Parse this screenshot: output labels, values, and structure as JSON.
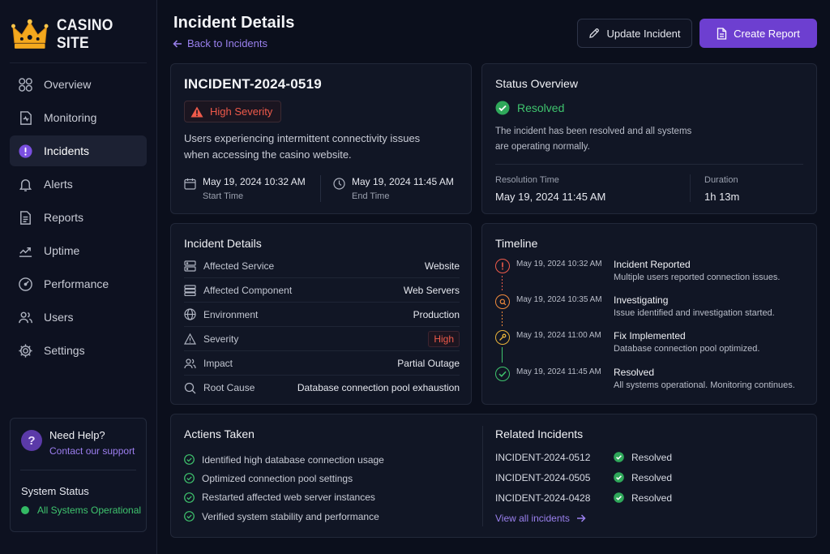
{
  "brand": {
    "name": "CASINO SITE"
  },
  "sidebar": {
    "items": [
      {
        "label": "Overview",
        "icon": "grid-icon",
        "active": false
      },
      {
        "label": "Monitoring",
        "icon": "monitor-doc-icon",
        "active": false
      },
      {
        "label": "Incidents",
        "icon": "alert-circle-icon",
        "active": true
      },
      {
        "label": "Alerts",
        "icon": "bell-icon",
        "active": false
      },
      {
        "label": "Reports",
        "icon": "document-icon",
        "active": false
      },
      {
        "label": "Uptime",
        "icon": "trend-up-icon",
        "active": false
      },
      {
        "label": "Performance",
        "icon": "gauge-icon",
        "active": false
      },
      {
        "label": "Users",
        "icon": "users-icon",
        "active": false
      },
      {
        "label": "Settings",
        "icon": "gear-icon",
        "active": false
      }
    ],
    "help": {
      "title": "Need Help?",
      "link": "Contact our support"
    },
    "system_status": {
      "title": "System Status",
      "value": "All Systems Operational"
    }
  },
  "header": {
    "title": "Incident Details",
    "back_label": "Back to Incidents",
    "update_label": "Update Incident",
    "report_label": "Create Report"
  },
  "incident": {
    "id": "INCIDENT-2024-0519",
    "severity": "High Severity",
    "description": "Users experiencing intermittent connectivity issues when accessing the casino website.",
    "start_time": "May 19, 2024 10:32 AM",
    "start_label": "Start Time",
    "end_time": "May 19, 2024 11:45 AM",
    "end_label": "End Time"
  },
  "status": {
    "title": "Status Overview",
    "value": "Resolved",
    "description": "The incident has been resolved and all systems are operating normally.",
    "resolution_label": "Resolution Time",
    "resolution_value": "May 19, 2024 11:45 AM",
    "duration_label": "Duration",
    "duration_value": "1h 13m"
  },
  "details": {
    "title": "Incident Details",
    "rows": [
      {
        "key": "Affected Service",
        "value": "Website",
        "icon": "server-icon"
      },
      {
        "key": "Affected Component",
        "value": "Web Servers",
        "icon": "server-stack-icon"
      },
      {
        "key": "Environment",
        "value": "Production",
        "icon": "globe-icon"
      },
      {
        "key": "Severity",
        "value": "High",
        "icon": "warning-icon"
      },
      {
        "key": "Impact",
        "value": "Partial Outage",
        "icon": "users-icon"
      },
      {
        "key": "Root Cause",
        "value": "Database connection pool exhaustion",
        "icon": "search-icon"
      }
    ]
  },
  "timeline": {
    "title": "Timeline",
    "events": [
      {
        "time": "May 19, 2024 10:32 AM",
        "title": "Incident Reported",
        "desc": "Multiple users reported connection issues.",
        "color": "#ef5a4a",
        "icon": "alert-icon"
      },
      {
        "time": "May 19, 2024 10:35 AM",
        "title": "Investigating",
        "desc": "Issue identified and investigation started.",
        "color": "#f08a3c",
        "icon": "search-icon"
      },
      {
        "time": "May 19, 2024 11:00 AM",
        "title": "Fix Implemented",
        "desc": "Database connection pool optimized.",
        "color": "#e9b33a",
        "icon": "wrench-icon"
      },
      {
        "time": "May 19, 2024 11:45 AM",
        "title": "Resolved",
        "desc": "All systems operational. Monitoring continues.",
        "color": "#3fc46e",
        "icon": "check-icon"
      }
    ]
  },
  "actions": {
    "title": "Actiens Taken",
    "items": [
      "Identified high database connection usage",
      "Optimized connection pool settings",
      "Restarted affected web server instances",
      "Verified system stability and performance"
    ]
  },
  "related": {
    "title": "Related Incidents",
    "items": [
      {
        "id": "INCIDENT-2024-0512",
        "status": "Resolved"
      },
      {
        "id": "INCIDENT-2024-0505",
        "status": "Resolved"
      },
      {
        "id": "INCIDENT-2024-0428",
        "status": "Resolved"
      }
    ],
    "view_all": "View all incidents"
  },
  "colors": {
    "accent": "#6d3fd0",
    "link": "#9a80ee",
    "success": "#3fc46e",
    "danger": "#ef5a4a",
    "background": "#0b0f1c",
    "card": "#111625"
  }
}
